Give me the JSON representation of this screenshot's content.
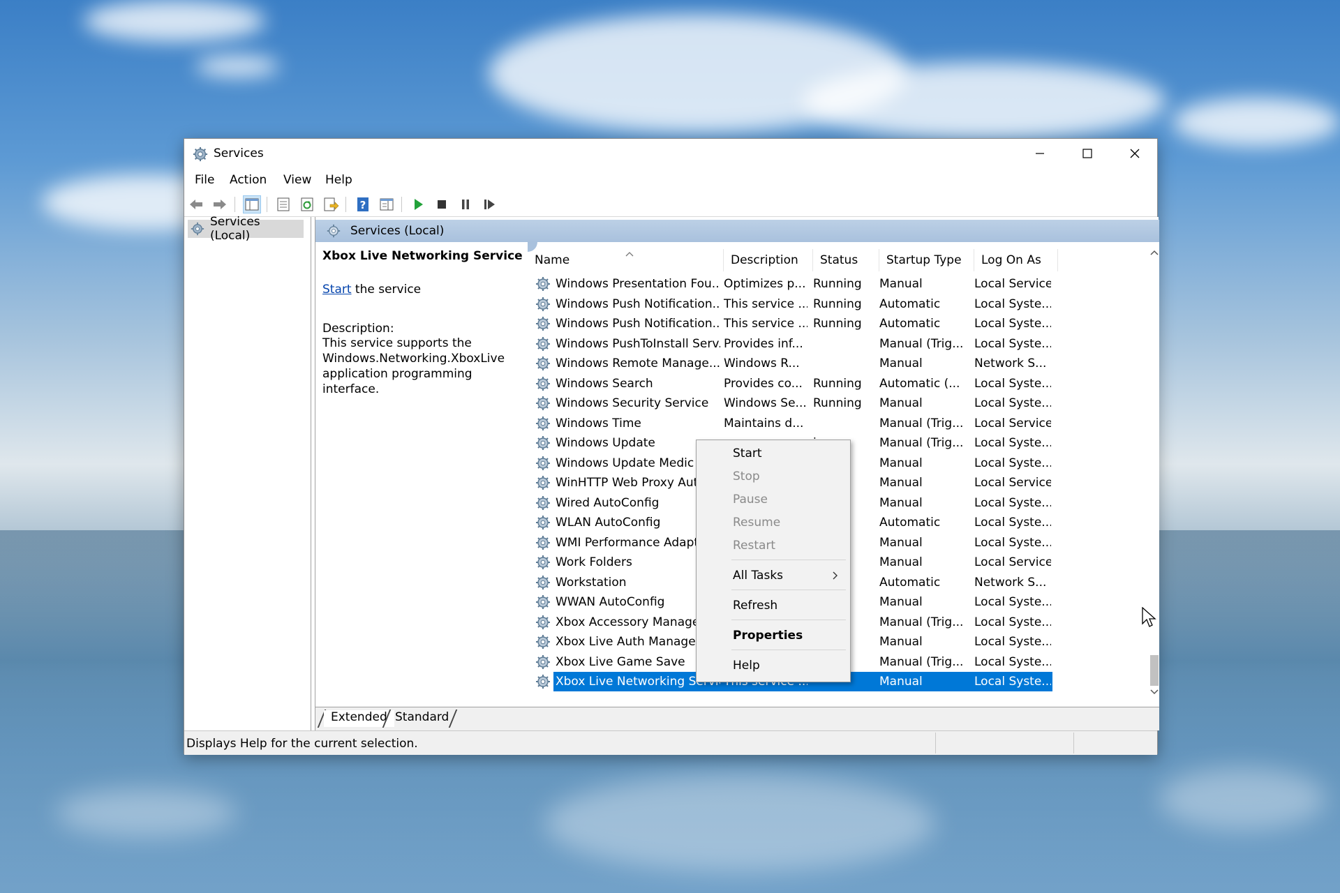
{
  "window": {
    "title": "Services",
    "controls": [
      "minimize",
      "maximize",
      "close"
    ]
  },
  "menubar": {
    "items": [
      "File",
      "Action",
      "View",
      "Help"
    ]
  },
  "toolbar": {
    "buttons": [
      "back-icon",
      "forward-icon",
      "show-hide-tree-icon",
      "properties-icon",
      "refresh-icon",
      "export-icon",
      "help-icon",
      "console-view-icon",
      "start-service-icon",
      "stop-service-icon",
      "pause-service-icon",
      "restart-service-icon"
    ]
  },
  "tree": {
    "node_label": "Services (Local)"
  },
  "main": {
    "header": "Services (Local)",
    "selected_service_title": "Xbox Live Networking Service",
    "start_link": "Start",
    "start_suffix": " the service",
    "description_label": "Description:",
    "description_lines": [
      "This service supports the",
      "Windows.Networking.XboxLive",
      "application programming interface."
    ]
  },
  "columns": [
    "Name",
    "Description",
    "Status",
    "Startup Type",
    "Log On As"
  ],
  "rows": [
    {
      "name": "Windows Presentation Fou...",
      "desc": "Optimizes p...",
      "status": "Running",
      "startup": "Manual",
      "logon": "Local Service"
    },
    {
      "name": "Windows Push Notification...",
      "desc": "This service ...",
      "status": "Running",
      "startup": "Automatic",
      "logon": "Local Syste..."
    },
    {
      "name": "Windows Push Notification...",
      "desc": "This service ...",
      "status": "Running",
      "startup": "Automatic",
      "logon": "Local Syste..."
    },
    {
      "name": "Windows PushToInstall Serv...",
      "desc": "Provides inf...",
      "status": "",
      "startup": "Manual (Trig...",
      "logon": "Local Syste..."
    },
    {
      "name": "Windows Remote Manage...",
      "desc": "Windows R...",
      "status": "",
      "startup": "Manual",
      "logon": "Network S..."
    },
    {
      "name": "Windows Search",
      "desc": "Provides co...",
      "status": "Running",
      "startup": "Automatic (...",
      "logon": "Local Syste..."
    },
    {
      "name": "Windows Security Service",
      "desc": "Windows Se...",
      "status": "Running",
      "startup": "Manual",
      "logon": "Local Syste..."
    },
    {
      "name": "Windows Time",
      "desc": "Maintains d...",
      "status": "",
      "startup": "Manual (Trig...",
      "logon": "Local Service"
    },
    {
      "name": "Windows Update",
      "desc": "",
      "status": "ing",
      "startup": "Manual (Trig...",
      "logon": "Local Syste..."
    },
    {
      "name": "Windows Update Medic",
      "desc": "",
      "status": "",
      "startup": "Manual",
      "logon": "Local Syste..."
    },
    {
      "name": "WinHTTP Web Proxy Aut",
      "desc": "",
      "status": "ing",
      "startup": "Manual",
      "logon": "Local Service"
    },
    {
      "name": "Wired AutoConfig",
      "desc": "",
      "status": "",
      "startup": "Manual",
      "logon": "Local Syste..."
    },
    {
      "name": "WLAN AutoConfig",
      "desc": "",
      "status": "ing",
      "startup": "Automatic",
      "logon": "Local Syste..."
    },
    {
      "name": "WMI Performance Adapt",
      "desc": "",
      "status": "",
      "startup": "Manual",
      "logon": "Local Syste..."
    },
    {
      "name": "Work Folders",
      "desc": "",
      "status": "",
      "startup": "Manual",
      "logon": "Local Service"
    },
    {
      "name": "Workstation",
      "desc": "",
      "status": "ing",
      "startup": "Automatic",
      "logon": "Network S..."
    },
    {
      "name": "WWAN AutoConfig",
      "desc": "",
      "status": "",
      "startup": "Manual",
      "logon": "Local Syste..."
    },
    {
      "name": "Xbox Accessory Manage",
      "desc": "",
      "status": "",
      "startup": "Manual (Trig...",
      "logon": "Local Syste..."
    },
    {
      "name": "Xbox Live Auth Manager",
      "desc": "",
      "status": "",
      "startup": "Manual",
      "logon": "Local Syste..."
    },
    {
      "name": "Xbox Live Game Save",
      "desc": "",
      "status": "",
      "startup": "Manual (Trig...",
      "logon": "Local Syste..."
    },
    {
      "name": "Xbox Live Networking Service",
      "desc": "This service ...",
      "status": "",
      "startup": "Manual",
      "logon": "Local Syste..."
    }
  ],
  "selected_row_index": 20,
  "context_menu": {
    "start": "Start",
    "stop": "Stop",
    "pause": "Pause",
    "resume": "Resume",
    "restart": "Restart",
    "all_tasks": "All Tasks",
    "refresh": "Refresh",
    "properties": "Properties",
    "help": "Help"
  },
  "tabs": [
    "Extended",
    "Standard"
  ],
  "active_tab": "Extended",
  "status_bar": {
    "text": "Displays Help for the current selection."
  },
  "colors": {
    "selection": "#0078d7",
    "header_band": "#a9c1dd",
    "link": "#0645ad"
  }
}
